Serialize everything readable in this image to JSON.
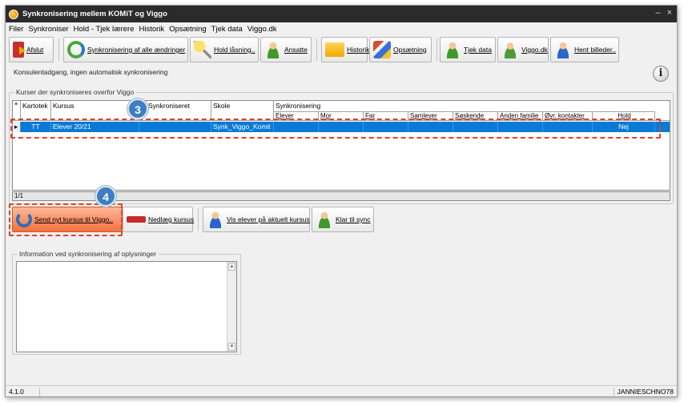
{
  "window": {
    "title": "Synkronisering mellem KOMiT og Viggo"
  },
  "menu": [
    "Filer",
    "Synkroniser",
    "Hold - Tjek lærere",
    "Historik",
    "Opsætning",
    "Tjek data",
    "Viggo.dk"
  ],
  "toolbar": {
    "exit": "Afslut",
    "sync_all": "Synkronisering af alle ændringer",
    "hold_lock": "Hold låsning..",
    "employees": "Ansatte",
    "history": "Historik",
    "setup": "Opsætning",
    "check_data": "Tjek data",
    "viggo": "Viggo.dk",
    "fetch_images": "Hent billeder.."
  },
  "status_line": "Konsulentadgang, ingen automatisk synkronisering",
  "courses_group": {
    "title": "Kurser der synkroniseres overfor Viggo",
    "headers": {
      "kartotek": "Kartotek",
      "kursus": "Kursus",
      "last_sync": "st Synkroniseret",
      "skole": "Skole",
      "synk": "Synkronisering"
    },
    "subheaders": [
      "Elever",
      "Mor",
      "Far",
      "Samlever",
      "Søskende",
      "Anden familie",
      "Øvr. kontakter",
      "Hold"
    ],
    "rows": [
      {
        "marker": "▸",
        "kartotek": "TT",
        "kursus": "Elever 20/21",
        "last_sync": "",
        "skole": "Synk_Viggo_Komit",
        "hold": "Nej"
      }
    ],
    "pager": "1/1"
  },
  "actions": {
    "send_new": "Send nyt kursus til Viggo..",
    "close_course": "Nedlæg kursus",
    "show_students": "Vis elever på aktuelt kursus",
    "ready_sync": "Klar til sync"
  },
  "info_group": {
    "title": "Information ved synkronisering af oplysninger",
    "text": ""
  },
  "statusbar": {
    "version": "4.1.0",
    "user": "JANNIESCHNO78"
  },
  "callouts": {
    "grid_step": "3",
    "send_step": "4"
  },
  "colors": {
    "selection": "#0a7ad6",
    "callout": "#d9442a",
    "badge": "#3d7fc1"
  }
}
